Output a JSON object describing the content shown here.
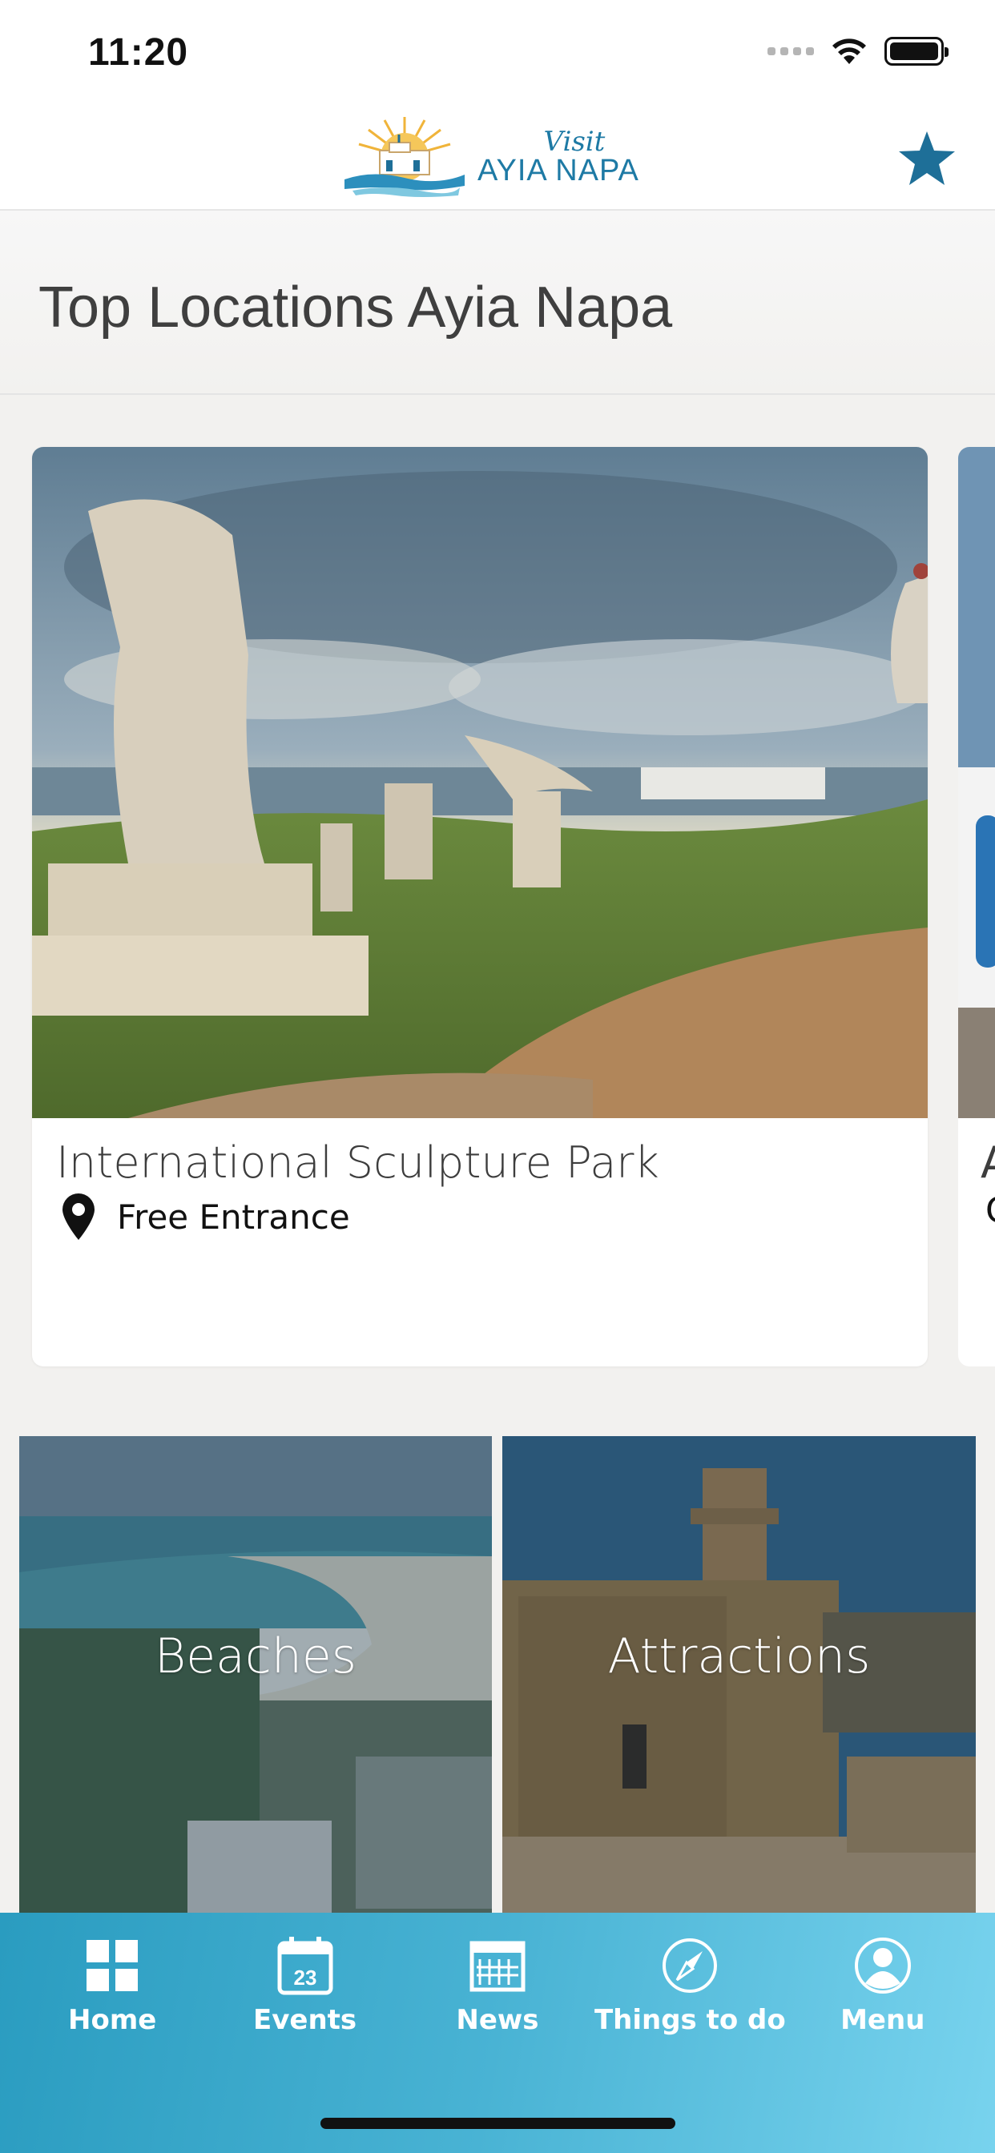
{
  "status_bar": {
    "time": "11:20"
  },
  "header": {
    "logo_visit": "Visit",
    "logo_name": "AYIA NAPA",
    "favorite_icon": "star-icon",
    "brand_color": "#1e6f98"
  },
  "page": {
    "title": "Top Locations Ayia Napa"
  },
  "carousel": {
    "cards": [
      {
        "title": "International Sculpture Park",
        "subtitle": "Free Entrance",
        "icon": "map-pin-icon"
      },
      {
        "title": "A",
        "subtitle": "C"
      }
    ]
  },
  "categories": [
    {
      "label": "Beaches"
    },
    {
      "label": "Attractions"
    }
  ],
  "tab_bar": {
    "items": [
      {
        "label": "Home",
        "icon": "grid-icon"
      },
      {
        "label": "Events",
        "icon": "calendar-icon",
        "calendar_day": "23"
      },
      {
        "label": "News",
        "icon": "newspaper-icon"
      },
      {
        "label": "Things to do",
        "icon": "compass-icon"
      },
      {
        "label": "Menu",
        "icon": "user-icon"
      }
    ],
    "gradient_start": "#2a9cc0",
    "gradient_end": "#78d3ee"
  }
}
